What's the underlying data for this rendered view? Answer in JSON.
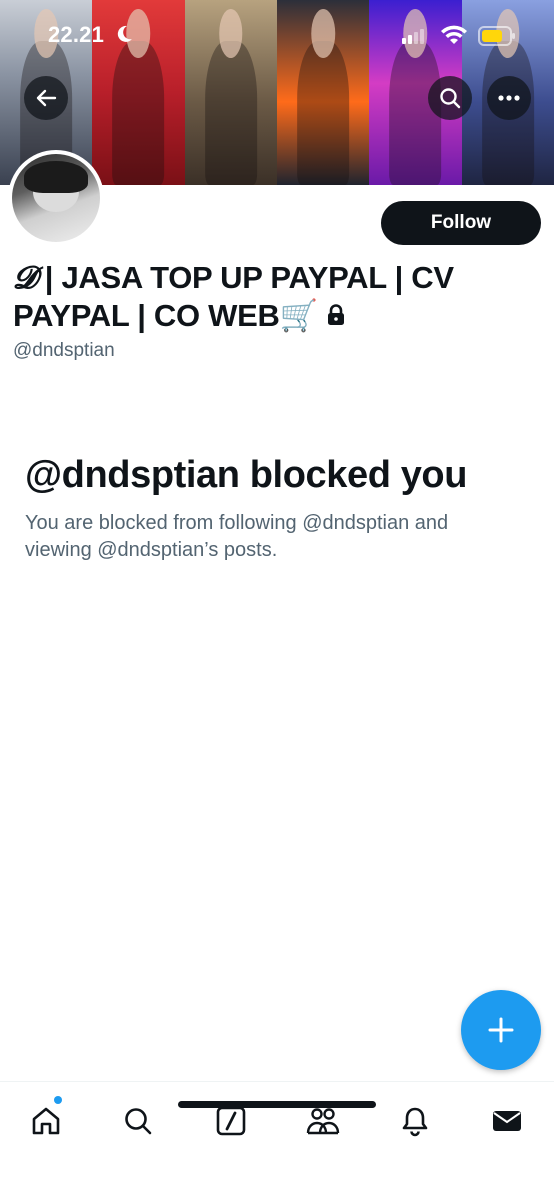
{
  "status_bar": {
    "time": "22.21"
  },
  "profile": {
    "display_name_prefix": "𝓓",
    "display_name": " | JASA TOP UP PAYPAL | CV PAYPAL | CO WEB🛒",
    "handle": "@dndsptian",
    "follow_label": "Follow",
    "protected": true
  },
  "blocked": {
    "title": "@dndsptian blocked you",
    "description": "You are blocked from following @dndsptian and viewing @dndsptian’s posts."
  },
  "nav": {
    "items": [
      "home-icon",
      "search-icon",
      "grok-icon",
      "communities-icon",
      "notifications-icon",
      "messages-icon"
    ]
  },
  "colors": {
    "accent": "#1d9bf0",
    "text_primary": "#0f1419",
    "text_secondary": "#536471"
  }
}
